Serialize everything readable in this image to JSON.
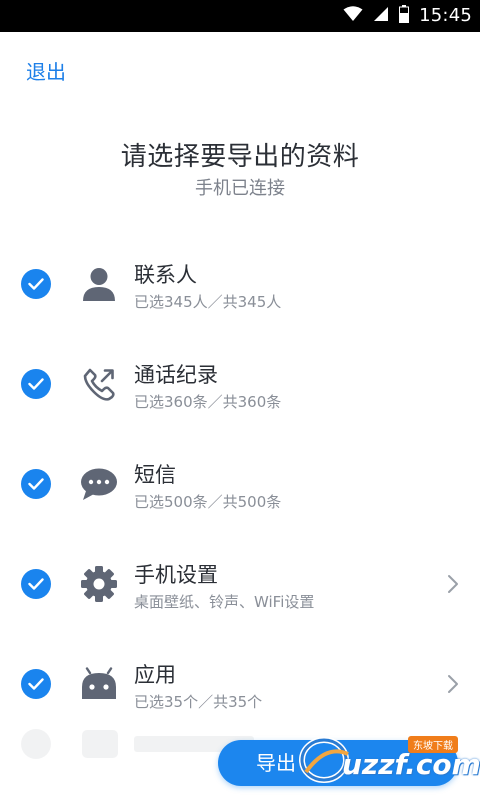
{
  "status_bar": {
    "time": "15:45",
    "icons": [
      "wifi-icon",
      "signal-icon",
      "battery-icon"
    ]
  },
  "header": {
    "exit_label": "退出"
  },
  "page": {
    "title": "请选择要导出的资料",
    "subtitle": "手机已连接"
  },
  "items": [
    {
      "icon": "contact-person-icon",
      "title": "联系人",
      "subtitle": "已选345人／共345人",
      "checked": true,
      "has_chevron": false
    },
    {
      "icon": "call-log-icon",
      "title": "通话纪录",
      "subtitle": "已选360条／共360条",
      "checked": true,
      "has_chevron": false
    },
    {
      "icon": "sms-bubble-icon",
      "title": "短信",
      "subtitle": "已选500条／共500条",
      "checked": true,
      "has_chevron": false
    },
    {
      "icon": "settings-gear-icon",
      "title": "手机设置",
      "subtitle": "桌面壁纸、铃声、WiFi设置",
      "checked": true,
      "has_chevron": true
    },
    {
      "icon": "android-app-icon",
      "title": "应用",
      "subtitle": "已选35个／共35个",
      "checked": true,
      "has_chevron": true
    }
  ],
  "footer": {
    "export_label": "导出"
  },
  "watermark": {
    "text": "uzzf.com",
    "badge": "东坡下载"
  },
  "colors": {
    "accent": "#1a84ee",
    "icon_gray": "#5f6675",
    "title_text": "#2b2f36",
    "muted_text": "#8a8f98"
  }
}
